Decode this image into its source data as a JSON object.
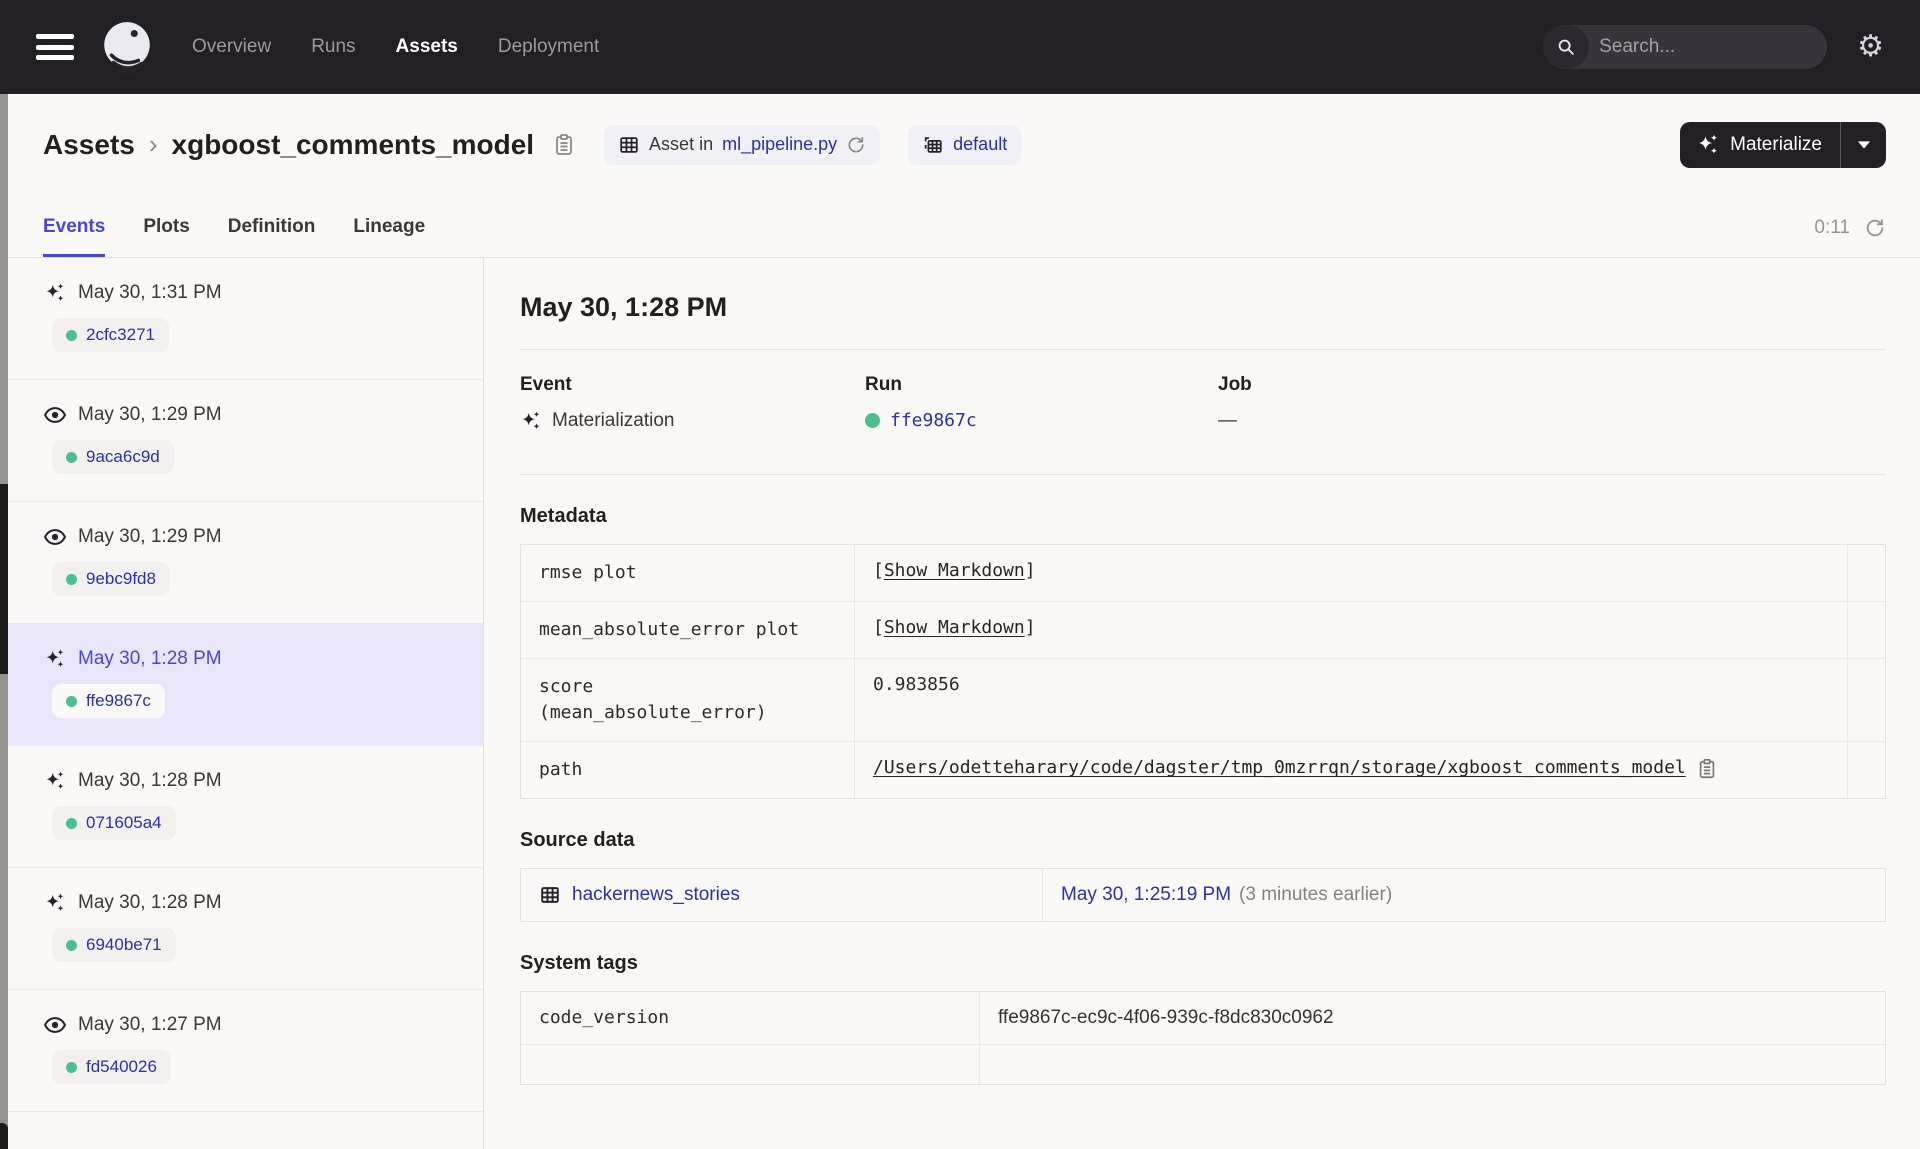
{
  "colors": {
    "header_bg": "#221F25",
    "accent": "#4B43DB",
    "link": "#2B2FB0",
    "success_green": "#4CBE8F",
    "selected_bg": "#E8E6F8"
  },
  "header": {
    "nav": [
      {
        "label": "Overview"
      },
      {
        "label": "Runs"
      },
      {
        "label": "Assets"
      },
      {
        "label": "Deployment"
      }
    ],
    "search_placeholder": "Search...",
    "search_shortcut": "/"
  },
  "breadcrumb": {
    "root": "Assets",
    "separator": "›",
    "current": "xgboost_comments_model"
  },
  "badges": {
    "asset_prefix": "Asset in",
    "asset_link": "ml_pipeline.py",
    "repo": "default"
  },
  "materialize": {
    "label": "Materialize"
  },
  "tabs": [
    {
      "label": "Events"
    },
    {
      "label": "Plots"
    },
    {
      "label": "Definition"
    },
    {
      "label": "Lineage"
    }
  ],
  "toolbar": {
    "timer": "0:11"
  },
  "events": [
    {
      "type": "materialization",
      "time": "May 30, 1:31 PM",
      "run_id": "2cfc3271"
    },
    {
      "type": "observation",
      "time": "May 30, 1:29 PM",
      "run_id": "9aca6c9d"
    },
    {
      "type": "observation",
      "time": "May 30, 1:29 PM",
      "run_id": "9ebc9fd8"
    },
    {
      "type": "materialization",
      "time": "May 30, 1:28 PM",
      "run_id": "ffe9867c"
    },
    {
      "type": "materialization",
      "time": "May 30, 1:28 PM",
      "run_id": "071605a4"
    },
    {
      "type": "materialization",
      "time": "May 30, 1:28 PM",
      "run_id": "6940be71"
    },
    {
      "type": "observation",
      "time": "May 30, 1:27 PM",
      "run_id": "fd540026"
    }
  ],
  "detail": {
    "title": "May 30, 1:28 PM",
    "columns": {
      "event_label": "Event",
      "event_value": "Materialization",
      "run_label": "Run",
      "run_value": "ffe9867c",
      "job_label": "Job",
      "job_value": "—"
    },
    "metadata": {
      "heading": "Metadata",
      "bracket_open": "[",
      "bracket_close": "]",
      "rows": [
        {
          "key": "rmse plot",
          "value": "Show Markdown"
        },
        {
          "key": "mean_absolute_error plot",
          "value": "Show Markdown"
        },
        {
          "key": "score\n(mean_absolute_error)",
          "value": "0.983856"
        },
        {
          "key": "path",
          "value": "/Users/odetteharary/code/dagster/tmp_0mzrrqn/storage/xgboost_comments_model"
        }
      ]
    },
    "source": {
      "heading": "Source data",
      "asset": "hackernews_stories",
      "timestamp": "May 30, 1:25:19 PM",
      "note": "(3 minutes earlier)"
    },
    "system_tags": {
      "heading": "System tags",
      "rows": [
        {
          "key": "code_version",
          "value": "ffe9867c-ec9c-4f06-939c-f8dc830c0962"
        }
      ]
    }
  }
}
